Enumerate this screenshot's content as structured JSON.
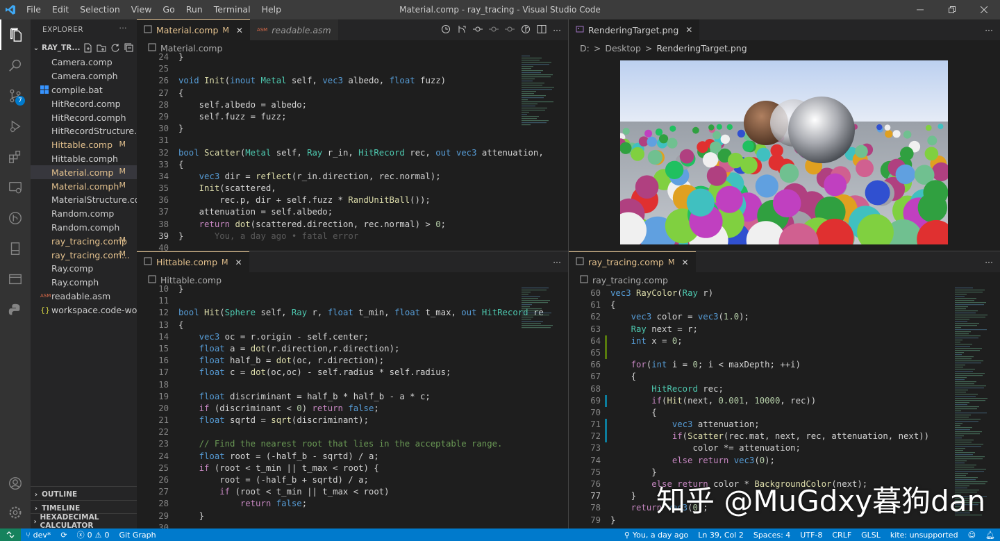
{
  "window": {
    "title": "Material.comp - ray_tracing - Visual Studio Code"
  },
  "menu": [
    "File",
    "Edit",
    "Selection",
    "View",
    "Go",
    "Run",
    "Terminal",
    "Help"
  ],
  "activity": {
    "scm_badge": "7"
  },
  "explorer": {
    "title": "EXPLORER",
    "folder": "RAY_TR...",
    "files": [
      {
        "name": "Camera.comp",
        "icon": "glsl",
        "mod": false
      },
      {
        "name": "Camera.comph",
        "icon": "glsl",
        "mod": false
      },
      {
        "name": "compile.bat",
        "icon": "windows",
        "mod": false
      },
      {
        "name": "HitRecord.comp",
        "icon": "glsl",
        "mod": false
      },
      {
        "name": "HitRecord.comph",
        "icon": "glsl",
        "mod": false
      },
      {
        "name": "HitRecordStructure.co...",
        "icon": "glsl",
        "mod": false
      },
      {
        "name": "Hittable.comp",
        "icon": "glsl",
        "mod": true,
        "badge": "M"
      },
      {
        "name": "Hittable.comph",
        "icon": "glsl",
        "mod": false
      },
      {
        "name": "Material.comp",
        "icon": "glsl",
        "mod": true,
        "badge": "M",
        "selected": true
      },
      {
        "name": "Material.comph",
        "icon": "glsl",
        "mod": true,
        "badge": "M"
      },
      {
        "name": "MaterialStructure.com...",
        "icon": "glsl",
        "mod": false
      },
      {
        "name": "Random.comp",
        "icon": "glsl",
        "mod": false
      },
      {
        "name": "Random.comph",
        "icon": "glsl",
        "mod": false
      },
      {
        "name": "ray_tracing.comp",
        "icon": "glsl",
        "mod": true,
        "badge": "M"
      },
      {
        "name": "ray_tracing.com...",
        "icon": "glsl",
        "mod": true,
        "badge": "M"
      },
      {
        "name": "Ray.comp",
        "icon": "glsl",
        "mod": false
      },
      {
        "name": "Ray.comph",
        "icon": "glsl",
        "mod": false
      },
      {
        "name": "readable.asm",
        "icon": "asm",
        "mod": false
      },
      {
        "name": "workspace.code-work...",
        "icon": "json",
        "mod": false
      }
    ],
    "sections": [
      "OUTLINE",
      "TIMELINE",
      "HEXADECIMAL CALCULATOR"
    ]
  },
  "pane1": {
    "tabs": [
      {
        "label": "Material.comp",
        "badge": "M",
        "active": true
      },
      {
        "label": "readable.asm",
        "active": false,
        "icon": "ASM"
      }
    ],
    "crumb": "Material.comp",
    "lines": [
      {
        "n": "24",
        "h": "}"
      },
      {
        "n": "25",
        "h": ""
      },
      {
        "n": "26",
        "h": "<span class=k>void</span> <span class=f>Init</span>(<span class=k>inout</span> <span class=t>Metal</span> self, <span class=k>vec3</span> albedo, <span class=k>float</span> fuzz)"
      },
      {
        "n": "27",
        "h": "{"
      },
      {
        "n": "28",
        "h": "    self.albedo = albedo;"
      },
      {
        "n": "29",
        "h": "    self.fuzz = fuzz;"
      },
      {
        "n": "30",
        "h": "}"
      },
      {
        "n": "31",
        "h": ""
      },
      {
        "n": "32",
        "h": "<span class=k>bool</span> <span class=f>Scatter</span>(<span class=t>Metal</span> self, <span class=t>Ray</span> r_in, <span class=t>HitRecord</span> rec, <span class=k>out</span> <span class=k>vec3</span> attenuation,"
      },
      {
        "n": "33",
        "h": "{"
      },
      {
        "n": "34",
        "h": "    <span class=k>vec3</span> dir = <span class=f>reflect</span>(r_in.direction, rec.normal);"
      },
      {
        "n": "35",
        "h": "    <span class=f>Init</span>(scattered,"
      },
      {
        "n": "36",
        "h": "        rec.p, dir + self.fuzz * <span class=f>RandUnitBall</span>());"
      },
      {
        "n": "37",
        "h": "    attenuation = self.albedo;"
      },
      {
        "n": "38",
        "h": "    <span class=p>return</span> <span class=f>dot</span>(scattered.direction, rec.normal) > <span class=n>0</span>;"
      },
      {
        "n": "39",
        "h": "}      <span class=g>You, a day ago • fatal error</span>",
        "cur": true
      },
      {
        "n": "40",
        "h": ""
      }
    ]
  },
  "pane2": {
    "tabs": [
      {
        "label": "Hittable.comp",
        "badge": "M",
        "active": true
      }
    ],
    "crumb": "Hittable.comp",
    "lines": [
      {
        "n": "10",
        "h": "}"
      },
      {
        "n": "11",
        "h": ""
      },
      {
        "n": "12",
        "h": "<span class=k>bool</span> <span class=f>Hit</span>(<span class=t>Sphere</span> self, <span class=t>Ray</span> r, <span class=k>float</span> t_min, <span class=k>float</span> t_max, <span class=k>out</span> <span class=t>HitRecord</span> re"
      },
      {
        "n": "13",
        "h": "{"
      },
      {
        "n": "14",
        "h": "    <span class=k>vec3</span> oc = r.origin - self.center;"
      },
      {
        "n": "15",
        "h": "    <span class=k>float</span> a = <span class=f>dot</span>(r.direction,r.direction);"
      },
      {
        "n": "16",
        "h": "    <span class=k>float</span> half_b = <span class=f>dot</span>(oc, r.direction);"
      },
      {
        "n": "17",
        "h": "    <span class=k>float</span> c = <span class=f>dot</span>(oc,oc) - self.radius * self.radius;"
      },
      {
        "n": "18",
        "h": ""
      },
      {
        "n": "19",
        "h": "    <span class=k>float</span> discriminant = half_b * half_b - a * c;"
      },
      {
        "n": "20",
        "h": "    <span class=p>if</span> (discriminant < <span class=n>0</span>) <span class=p>return</span> <span class=k>false</span>;"
      },
      {
        "n": "21",
        "h": "    <span class=k>float</span> sqrtd = <span class=f>sqrt</span>(discriminant);"
      },
      {
        "n": "22",
        "h": ""
      },
      {
        "n": "23",
        "h": "    <span class=c>// Find the nearest root that lies in the acceptable range.</span>"
      },
      {
        "n": "24",
        "h": "    <span class=k>float</span> root = (-half_b - sqrtd) / a;"
      },
      {
        "n": "25",
        "h": "    <span class=p>if</span> (root < t_min || t_max < root) {"
      },
      {
        "n": "26",
        "h": "        root = (-half_b + sqrtd) / a;"
      },
      {
        "n": "27",
        "h": "        <span class=p>if</span> (root < t_min || t_max < root)"
      },
      {
        "n": "28",
        "h": "            <span class=p>return</span> <span class=k>false</span>;"
      },
      {
        "n": "29",
        "h": "    }"
      },
      {
        "n": "30",
        "h": ""
      }
    ]
  },
  "pane3": {
    "tabs": [
      {
        "label": "RenderingTarget.png",
        "active": true,
        "icon": "img",
        "plain": true
      }
    ],
    "crumb_parts": [
      "D:",
      ">",
      "Desktop",
      ">",
      "RenderingTarget.png"
    ]
  },
  "pane4": {
    "tabs": [
      {
        "label": "ray_tracing.comp",
        "badge": "M",
        "active": true
      }
    ],
    "crumb": "ray_tracing.comp",
    "lines": [
      {
        "n": "60",
        "h": "<span class=k>vec3</span> <span class=f>RayColor</span>(<span class=t>Ray</span> r)"
      },
      {
        "n": "61",
        "h": "{"
      },
      {
        "n": "62",
        "h": "    <span class=k>vec3</span> color = <span class=k>vec3</span>(<span class=n>1.0</span>);"
      },
      {
        "n": "63",
        "h": "    <span class=t>Ray</span> next = r;"
      },
      {
        "n": "64",
        "h": "    <span class=k>int</span> x = <span class=n>0</span>;",
        "g": "mk"
      },
      {
        "n": "65",
        "h": "",
        "g": "mk"
      },
      {
        "n": "66",
        "h": "    <span class=p>for</span>(<span class=k>int</span> i = <span class=n>0</span>; i < maxDepth; ++i)"
      },
      {
        "n": "67",
        "h": "    {"
      },
      {
        "n": "68",
        "h": "        <span class=t>HitRecord</span> rec;"
      },
      {
        "n": "69",
        "h": "        <span class=p>if</span>(<span class=f>Hit</span>(next, <span class=n>0.001</span>, <span class=n>10000</span>, rec))",
        "g": "mm"
      },
      {
        "n": "70",
        "h": "        {"
      },
      {
        "n": "71",
        "h": "            <span class=k>vec3</span> attenuation;",
        "g": "mm"
      },
      {
        "n": "72",
        "h": "            <span class=p>if</span>(<span class=f>Scatter</span>(rec.mat, next, rec, attenuation, next))",
        "g": "mm"
      },
      {
        "n": "73",
        "h": "                color *= attenuation;"
      },
      {
        "n": "74",
        "h": "            <span class=p>else</span> <span class=p>return</span> <span class=k>vec3</span>(<span class=n>0</span>);"
      },
      {
        "n": "75",
        "h": "        }"
      },
      {
        "n": "76",
        "h": "        <span class=p>else</span> <span class=p>return</span> color * <span class=f>BackgroundColor</span>(next);"
      },
      {
        "n": "77",
        "h": "    }",
        "cur": true
      },
      {
        "n": "78",
        "h": "    <span class=p>return</span> <span class=k>vec3</span>(<span class=n>0</span>);"
      },
      {
        "n": "79",
        "h": "}"
      }
    ]
  },
  "watermark": "知乎 @MuGdxy暮狗dan",
  "status": {
    "branch": "dev*",
    "errors": "0",
    "warnings": "0",
    "gitgraph": "Git Graph",
    "blame": "You, a day ago",
    "position": "Ln 39, Col 2",
    "spaces": "Spaces: 4",
    "encoding": "UTF-8",
    "eol": "CRLF",
    "lang": "GLSL",
    "kite": "kite: unsupported"
  },
  "colors": {
    "accent": "#007acc",
    "modified": "#e2c08d"
  }
}
